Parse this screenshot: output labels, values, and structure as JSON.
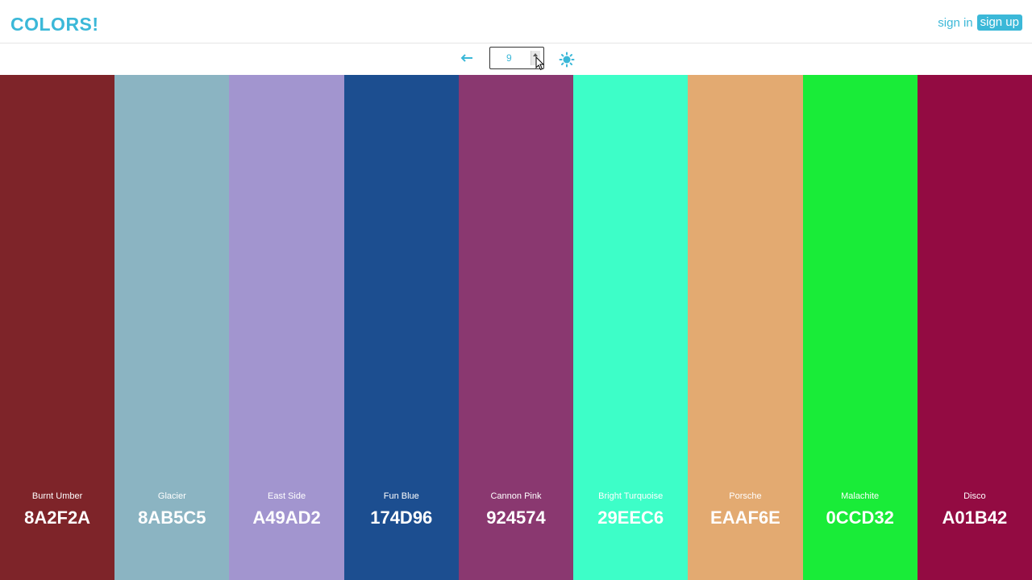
{
  "header": {
    "logo": "COLORS!",
    "sign_in": "sign in",
    "sign_up": "sign up"
  },
  "toolbar": {
    "back_icon": "left-arrow-icon",
    "count": "9",
    "theme_icon": "sun-icon"
  },
  "colors": {
    "accent": "#3bb8d8"
  },
  "swatches": [
    {
      "name": "Burnt Umber",
      "hex": "8A2F2A",
      "color": "#7e2429"
    },
    {
      "name": "Glacier",
      "hex": "8AB5C5",
      "color": "#8bb4c2"
    },
    {
      "name": "East Side",
      "hex": "A49AD2",
      "color": "#a295cf"
    },
    {
      "name": "Fun Blue",
      "hex": "174D96",
      "color": "#1c4e90"
    },
    {
      "name": "Cannon Pink",
      "hex": "924574",
      "color": "#8a3870"
    },
    {
      "name": "Bright Turquoise",
      "hex": "29EEC6",
      "color": "#3dfec8"
    },
    {
      "name": "Porsche",
      "hex": "EAAF6E",
      "color": "#e3aa71"
    },
    {
      "name": "Malachite",
      "hex": "0CCD32",
      "color": "#19ec38"
    },
    {
      "name": "Disco",
      "hex": "A01B42",
      "color": "#930b42"
    }
  ]
}
